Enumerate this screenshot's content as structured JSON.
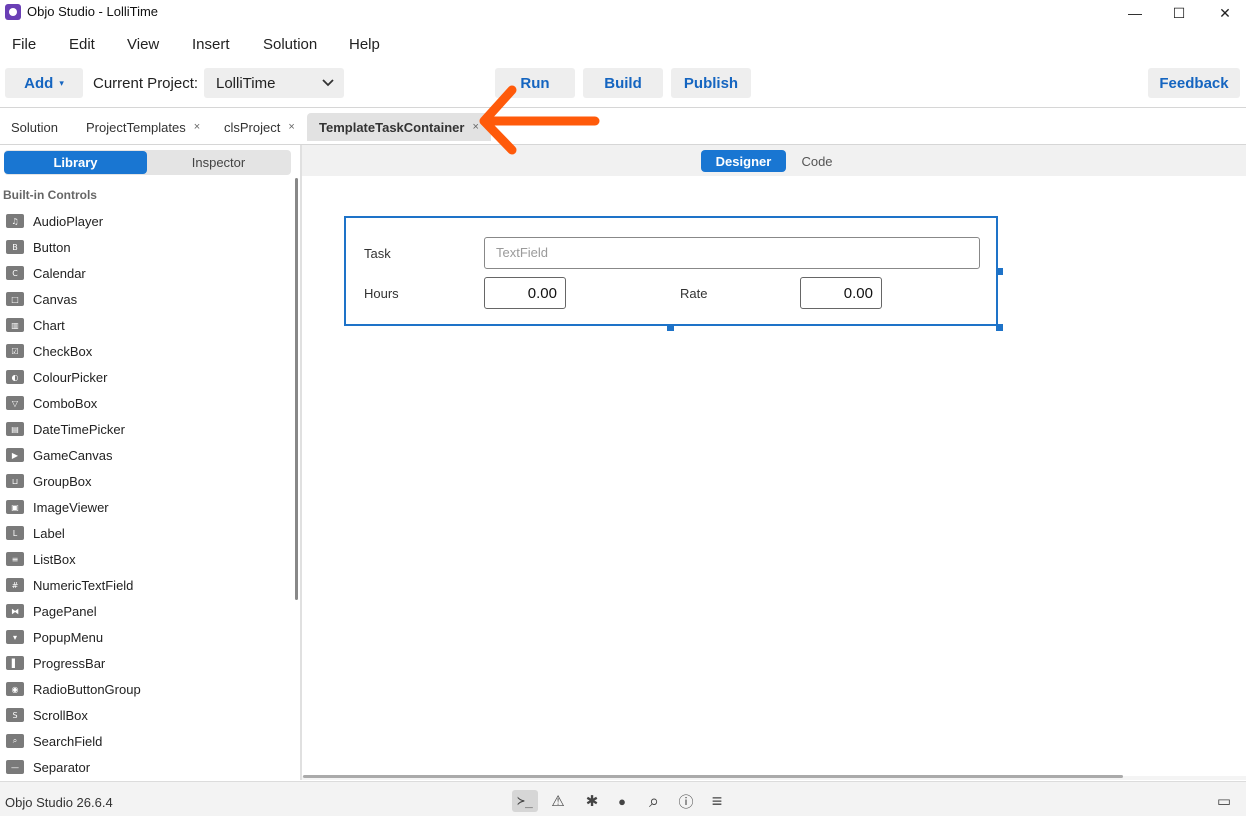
{
  "window": {
    "title": "Objo Studio - LolliTime",
    "controls": {
      "minimize": "—",
      "maximize": "☐",
      "close": "✕"
    }
  },
  "menu": [
    "File",
    "Edit",
    "View",
    "Insert",
    "Solution",
    "Help"
  ],
  "toolbar": {
    "add_label": "Add",
    "add_caret": "▾",
    "current_project_label": "Current Project:",
    "project_value": "LolliTime",
    "run_label": "Run",
    "build_label": "Build",
    "publish_label": "Publish",
    "feedback_label": "Feedback"
  },
  "tabs": {
    "solution": "Solution",
    "items": [
      {
        "label": "ProjectTemplates",
        "close": "×"
      },
      {
        "label": "clsProject",
        "close": "×"
      },
      {
        "label": "TemplateTaskContainer",
        "close": "×",
        "active": true
      }
    ]
  },
  "left_panel": {
    "library_label": "Library",
    "inspector_label": "Inspector",
    "section_header": "Built-in Controls",
    "items": [
      {
        "label": "AudioPlayer",
        "icon": "♫"
      },
      {
        "label": "Button",
        "icon": "B"
      },
      {
        "label": "Calendar",
        "icon": "C"
      },
      {
        "label": "Canvas",
        "icon": "□"
      },
      {
        "label": "Chart",
        "icon": "▥"
      },
      {
        "label": "CheckBox",
        "icon": "☑"
      },
      {
        "label": "ColourPicker",
        "icon": "◐"
      },
      {
        "label": "ComboBox",
        "icon": "▽"
      },
      {
        "label": "DateTimePicker",
        "icon": "▤"
      },
      {
        "label": "GameCanvas",
        "icon": "▶"
      },
      {
        "label": "GroupBox",
        "icon": "⊔"
      },
      {
        "label": "ImageViewer",
        "icon": "▣"
      },
      {
        "label": "Label",
        "icon": "L"
      },
      {
        "label": "ListBox",
        "icon": "≡"
      },
      {
        "label": "NumericTextField",
        "icon": "#"
      },
      {
        "label": "PagePanel",
        "icon": "⧓"
      },
      {
        "label": "PopupMenu",
        "icon": "▾"
      },
      {
        "label": "ProgressBar",
        "icon": "▌"
      },
      {
        "label": "RadioButtonGroup",
        "icon": "◉"
      },
      {
        "label": "ScrollBox",
        "icon": "S"
      },
      {
        "label": "SearchField",
        "icon": "⌕"
      },
      {
        "label": "Separator",
        "icon": "—"
      }
    ]
  },
  "designer": {
    "designer_label": "Designer",
    "code_label": "Code",
    "form": {
      "task_label": "Task",
      "task_placeholder": "TextField",
      "hours_label": "Hours",
      "hours_value": "0.00",
      "rate_label": "Rate",
      "rate_value": "0.00"
    }
  },
  "statusbar": {
    "version": "Objo Studio 26.6.4",
    "icons": {
      "terminal": "≻_",
      "warning": "⚠",
      "bug": "✱",
      "record": "●",
      "search": "⌕",
      "info": "ⓘ",
      "list": "≡",
      "chat": "▭"
    }
  },
  "colors": {
    "accent": "#1976d2",
    "annotation": "#ff5a0a"
  }
}
